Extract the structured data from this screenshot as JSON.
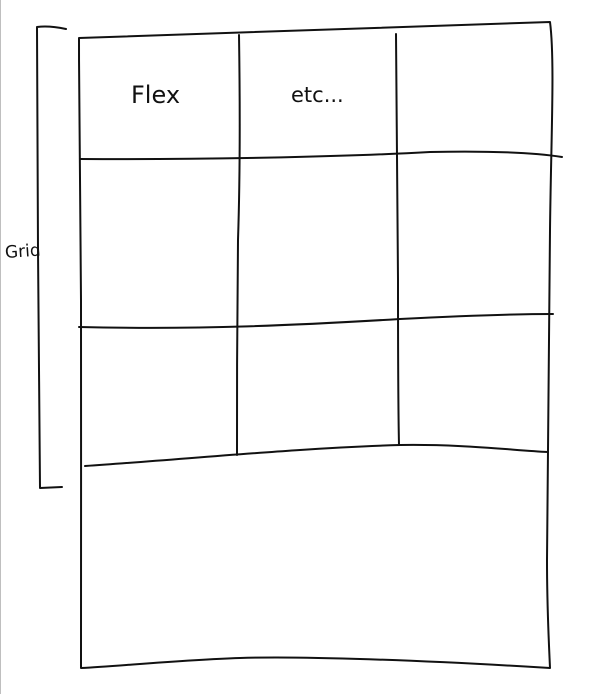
{
  "labels": {
    "grid": "Grid",
    "flex": "Flex",
    "etc": "etc..."
  },
  "colors": {
    "ink": "#111111",
    "background": "#ffffff",
    "edge": "#bfbfbf"
  }
}
